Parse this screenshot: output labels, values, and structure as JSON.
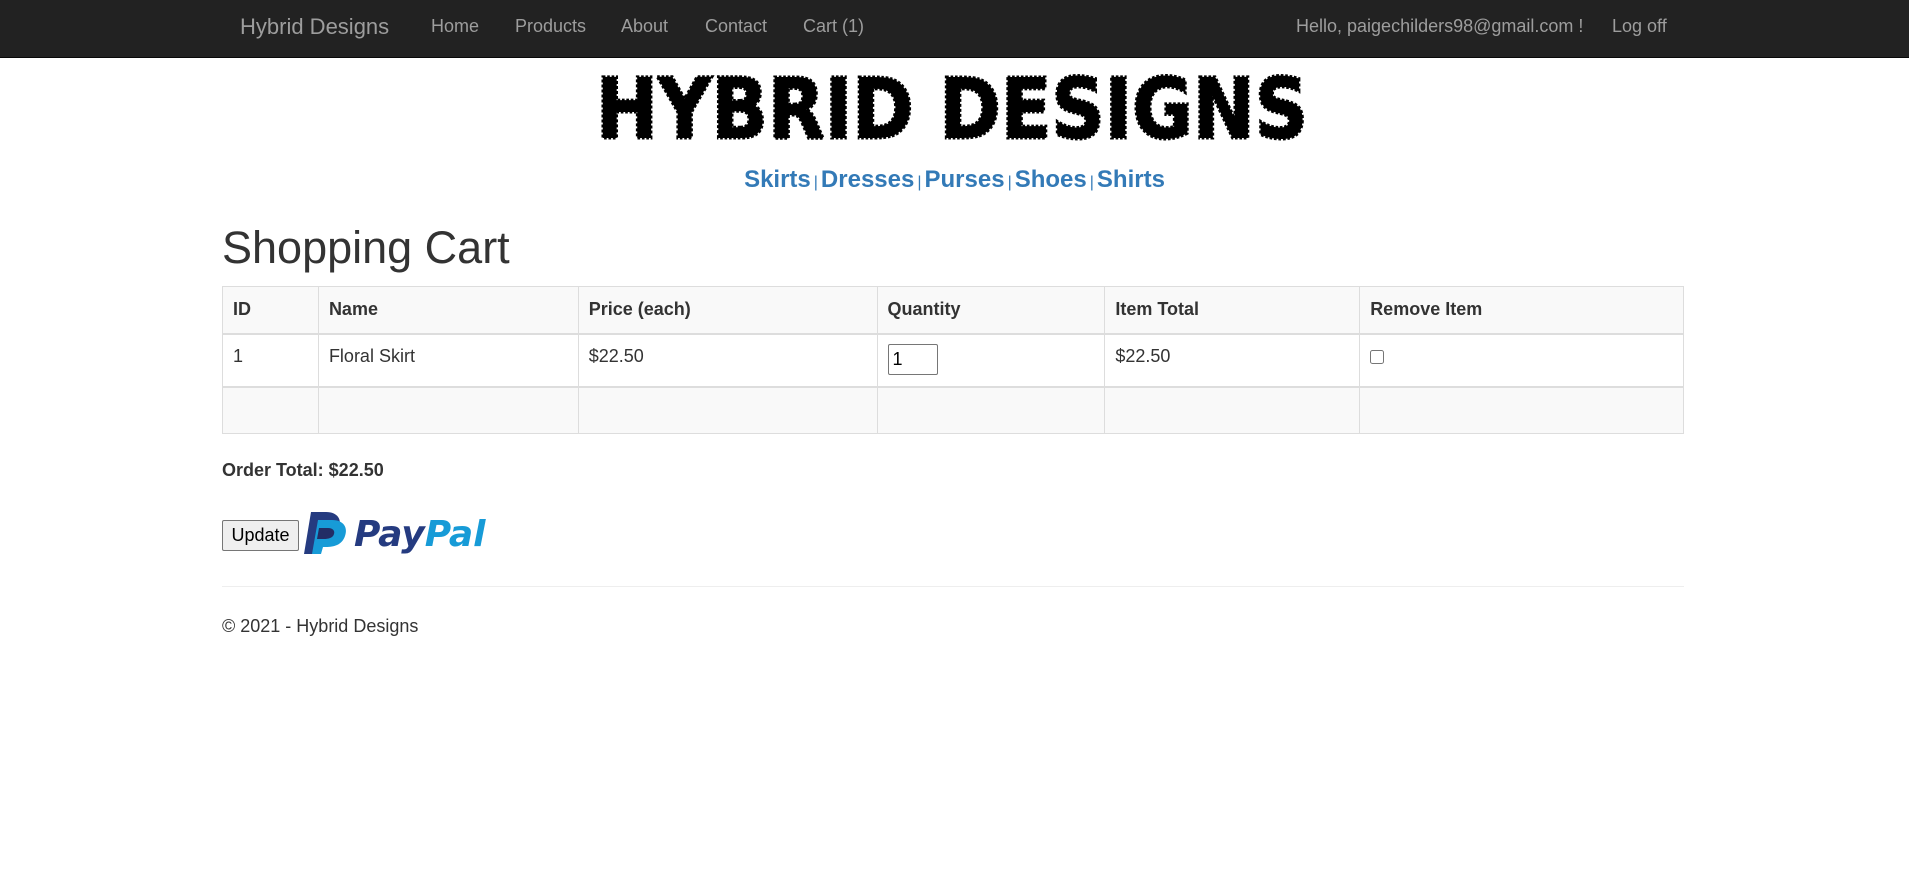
{
  "nav": {
    "brand": "Hybrid Designs",
    "links": [
      "Home",
      "Products",
      "About",
      "Contact",
      "Cart (1)"
    ],
    "greeting": "Hello, paigechilders98@gmail.com !",
    "logoff": "Log off"
  },
  "logo": {
    "text": "HYBRID DESIGNS"
  },
  "categories": [
    "Skirts",
    "Dresses",
    "Purses",
    "Shoes",
    "Shirts"
  ],
  "category_separator": "|",
  "page_title": "Shopping Cart",
  "cart_table": {
    "headers": [
      "ID",
      "Name",
      "Price (each)",
      "Quantity",
      "Item Total",
      "Remove Item"
    ],
    "rows": [
      {
        "id": "1",
        "name": "Floral Skirt",
        "price": "$22.50",
        "quantity": "1",
        "item_total": "$22.50",
        "remove": false
      }
    ]
  },
  "order_total": "Order Total: $22.50",
  "update_label": "Update",
  "paypal": {
    "label": "PayPal",
    "icon": "paypal-icon"
  },
  "footer": "© 2021 - Hybrid Designs",
  "colors": {
    "navbar": "#222222",
    "nav_text": "#9d9d9d",
    "link": "#337ab7",
    "paypal_dark": "#253b80",
    "paypal_light": "#179bd7"
  }
}
